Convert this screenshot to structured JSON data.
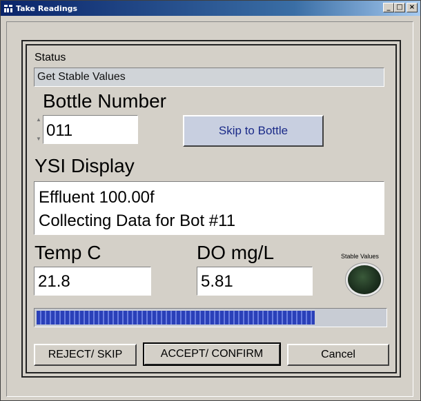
{
  "window": {
    "title": "Take Readings",
    "buttons": [
      "minimize",
      "maximize",
      "close"
    ]
  },
  "status": {
    "label": "Status",
    "value": "Get Stable Values"
  },
  "bottle": {
    "label": "Bottle Number",
    "value": "011",
    "skip_label": "Skip to Bottle"
  },
  "ysi": {
    "label": "YSI Display",
    "line1": "Effluent 100.00f",
    "line2": "Collecting Data for Bot #11"
  },
  "temp": {
    "label": "Temp C",
    "value": "21.8"
  },
  "do": {
    "label": "DO mg/L",
    "value": "5.81"
  },
  "stable": {
    "label": "Stable Values",
    "on": false,
    "color": "#1e3220"
  },
  "progress": {
    "fraction": 0.8
  },
  "actions": {
    "reject": "REJECT/ SKIP",
    "accept": "ACCEPT/ CONFIRM",
    "cancel": "Cancel"
  }
}
